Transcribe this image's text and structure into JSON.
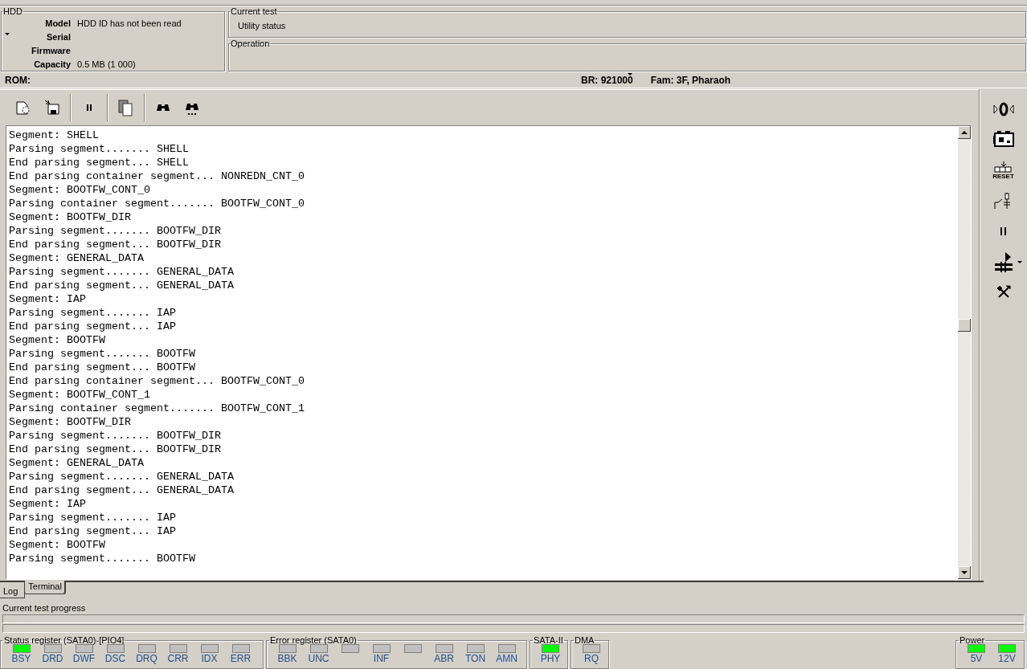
{
  "hdd": {
    "title": "HDD",
    "fields": [
      {
        "label": "Model",
        "value": "HDD ID has not been read"
      },
      {
        "label": "Serial"
      },
      {
        "label": "Firmware"
      },
      {
        "label": "Capacity",
        "value": "0.5 MB (1 000)"
      }
    ]
  },
  "current_test": {
    "title": "Current test",
    "value": "Utility status"
  },
  "operation": {
    "title": "Operation"
  },
  "info_bar": {
    "rom": "ROM:",
    "br": "BR: 921000",
    "fam": "Fam: 3F, Pharaoh"
  },
  "log": {
    "lines": [
      "Segment: SHELL",
      "Parsing segment....... SHELL",
      "End parsing segment... SHELL",
      "End parsing container segment... NONREDN_CNT_0",
      "Segment: BOOTFW_CONT_0",
      "Parsing container segment....... BOOTFW_CONT_0",
      "Segment: BOOTFW_DIR",
      "Parsing segment....... BOOTFW_DIR",
      "End parsing segment... BOOTFW_DIR",
      "Segment: GENERAL_DATA",
      "Parsing segment....... GENERAL_DATA",
      "End parsing segment... GENERAL_DATA",
      "Segment: IAP",
      "Parsing segment....... IAP",
      "End parsing segment... IAP",
      "Segment: BOOTFW",
      "Parsing segment....... BOOTFW",
      "End parsing segment... BOOTFW",
      "End parsing container segment... BOOTFW_CONT_0",
      "Segment: BOOTFW_CONT_1",
      "Parsing container segment....... BOOTFW_CONT_1",
      "Segment: BOOTFW_DIR",
      "Parsing segment....... BOOTFW_DIR",
      "End parsing segment... BOOTFW_DIR",
      "Segment: GENERAL_DATA",
      "Parsing segment....... GENERAL_DATA",
      "End parsing segment... GENERAL_DATA",
      "Segment: IAP",
      "Parsing segment....... IAP",
      "End parsing segment... IAP",
      "Segment: BOOTFW",
      "Parsing segment....... BOOTFW"
    ]
  },
  "side_tools": [
    {
      "kind": "zero"
    },
    {
      "kind": "board"
    },
    {
      "kind": "reset",
      "label": "RESET"
    },
    {
      "kind": "switch"
    },
    {
      "kind": "pause"
    },
    {
      "kind": "cable"
    },
    {
      "kind": "tools"
    }
  ],
  "tabs": [
    {
      "label": "Log",
      "selected": true
    },
    {
      "label": "Terminal",
      "selected": false
    }
  ],
  "progress": {
    "label": "Current test progress"
  },
  "registers": [
    {
      "title": "Status register (SATA0)-[PIO4]",
      "leds": [
        {
          "label": "BSY",
          "on": true
        },
        {
          "label": "DRD",
          "on": false
        },
        {
          "label": "DWF",
          "on": false
        },
        {
          "label": "DSC",
          "on": false
        },
        {
          "label": "DRQ",
          "on": false
        },
        {
          "label": "CRR",
          "on": false
        },
        {
          "label": "IDX",
          "on": false
        },
        {
          "label": "ERR",
          "on": false
        }
      ]
    },
    {
      "title": "Error register (SATA0)",
      "leds": [
        {
          "label": "BBK",
          "on": false
        },
        {
          "label": "UNC",
          "on": false
        },
        {
          "on": false
        },
        {
          "label": "INF",
          "on": false
        },
        {
          "on": false
        },
        {
          "label": "ABR",
          "on": false
        },
        {
          "label": "TON",
          "on": false
        },
        {
          "label": "AMN",
          "on": false
        }
      ]
    },
    {
      "title": "SATA-II",
      "leds": [
        {
          "label": "PHY",
          "on": true
        }
      ]
    },
    {
      "title": "DMA",
      "leds": [
        {
          "label": "RQ",
          "on": false
        }
      ]
    }
  ],
  "power": {
    "title": "Power",
    "leds": [
      {
        "label": "5V",
        "on": true
      },
      {
        "label": "12V",
        "on": true
      }
    ]
  }
}
